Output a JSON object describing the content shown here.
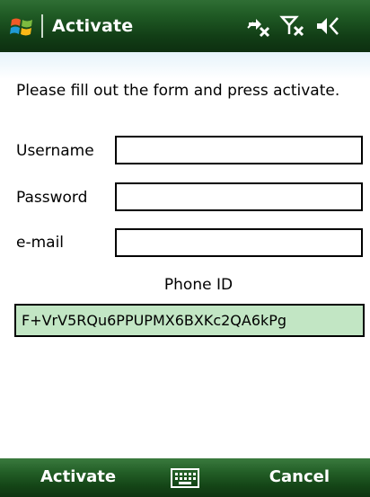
{
  "titlebar": {
    "title": "Activate",
    "icons": [
      "windows-start-icon",
      "data-connection-off-icon",
      "signal-off-icon",
      "volume-icon"
    ]
  },
  "form": {
    "instructions": "Please fill out the form and press activate.",
    "username_label": "Username",
    "username_value": "",
    "password_label": "Password",
    "password_value": "",
    "email_label": "e-mail",
    "email_value": "",
    "phone_id_label": "Phone ID",
    "phone_id_value": "F+VrV5RQu6PPUPMX6BXKc2QA6kPg"
  },
  "menubar": {
    "left_softkey": "Activate",
    "right_softkey": "Cancel",
    "center_icon": "keyboard-icon"
  },
  "colors": {
    "titlebar_green": "#1f5a24",
    "phone_id_bg": "#c2e6c4",
    "text": "#000000"
  }
}
